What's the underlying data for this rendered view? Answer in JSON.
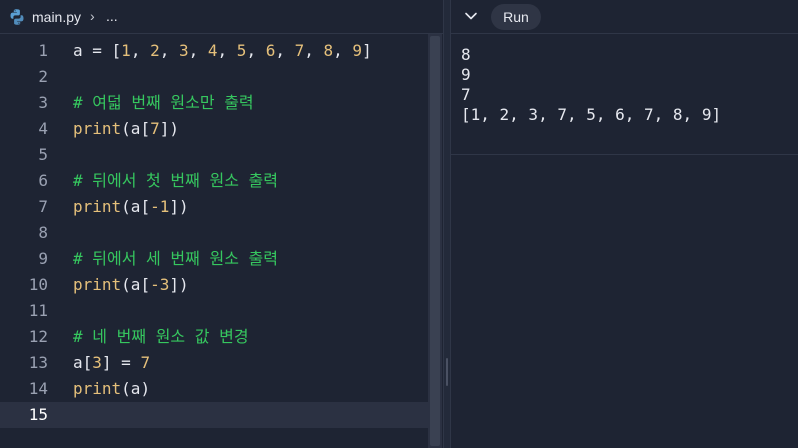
{
  "editor": {
    "file_name": "main.py",
    "breadcrumb_sep": "›",
    "breadcrumb_more": "...",
    "lines": [
      {
        "num": "1",
        "tokens": [
          {
            "t": "a = [",
            "c": "var"
          },
          {
            "t": "1",
            "c": "num"
          },
          {
            "t": ", ",
            "c": "op"
          },
          {
            "t": "2",
            "c": "num"
          },
          {
            "t": ", ",
            "c": "op"
          },
          {
            "t": "3",
            "c": "num"
          },
          {
            "t": ", ",
            "c": "op"
          },
          {
            "t": "4",
            "c": "num"
          },
          {
            "t": ", ",
            "c": "op"
          },
          {
            "t": "5",
            "c": "num"
          },
          {
            "t": ", ",
            "c": "op"
          },
          {
            "t": "6",
            "c": "num"
          },
          {
            "t": ", ",
            "c": "op"
          },
          {
            "t": "7",
            "c": "num"
          },
          {
            "t": ", ",
            "c": "op"
          },
          {
            "t": "8",
            "c": "num"
          },
          {
            "t": ", ",
            "c": "op"
          },
          {
            "t": "9",
            "c": "num"
          },
          {
            "t": "]",
            "c": "op"
          }
        ]
      },
      {
        "num": "2",
        "tokens": []
      },
      {
        "num": "3",
        "tokens": [
          {
            "t": "# 여덟 번째 원소만 출력",
            "c": "com"
          }
        ]
      },
      {
        "num": "4",
        "tokens": [
          {
            "t": "print",
            "c": "fn"
          },
          {
            "t": "(a[",
            "c": "var"
          },
          {
            "t": "7",
            "c": "num"
          },
          {
            "t": "])",
            "c": "var"
          }
        ]
      },
      {
        "num": "5",
        "tokens": []
      },
      {
        "num": "6",
        "tokens": [
          {
            "t": "# 뒤에서 첫 번째 원소 출력",
            "c": "com"
          }
        ]
      },
      {
        "num": "7",
        "tokens": [
          {
            "t": "print",
            "c": "fn"
          },
          {
            "t": "(a[",
            "c": "var"
          },
          {
            "t": "-1",
            "c": "num"
          },
          {
            "t": "])",
            "c": "var"
          }
        ]
      },
      {
        "num": "8",
        "tokens": []
      },
      {
        "num": "9",
        "tokens": [
          {
            "t": "# 뒤에서 세 번째 원소 출력",
            "c": "com"
          }
        ]
      },
      {
        "num": "10",
        "tokens": [
          {
            "t": "print",
            "c": "fn"
          },
          {
            "t": "(a[",
            "c": "var"
          },
          {
            "t": "-3",
            "c": "num"
          },
          {
            "t": "])",
            "c": "var"
          }
        ]
      },
      {
        "num": "11",
        "tokens": []
      },
      {
        "num": "12",
        "tokens": [
          {
            "t": "# 네 번째 원소 값 변경",
            "c": "com"
          }
        ]
      },
      {
        "num": "13",
        "tokens": [
          {
            "t": "a[",
            "c": "var"
          },
          {
            "t": "3",
            "c": "num"
          },
          {
            "t": "] = ",
            "c": "var"
          },
          {
            "t": "7",
            "c": "num"
          }
        ]
      },
      {
        "num": "14",
        "tokens": [
          {
            "t": "print",
            "c": "fn"
          },
          {
            "t": "(a)",
            "c": "var"
          }
        ]
      },
      {
        "num": "15",
        "tokens": [],
        "active": true
      }
    ]
  },
  "output": {
    "run_label": "Run",
    "lines": [
      "8",
      "9",
      "7",
      "[1, 2, 3, 7, 5, 6, 7, 8, 9]"
    ]
  },
  "icons": {
    "file_icon": "python-icon",
    "collapse_icon": "chevron-down-icon"
  },
  "colors": {
    "background": "#1e2433",
    "comment": "#36c75f",
    "number": "#e5c07b",
    "function": "#e5c07b",
    "text": "#e6e8ef"
  }
}
